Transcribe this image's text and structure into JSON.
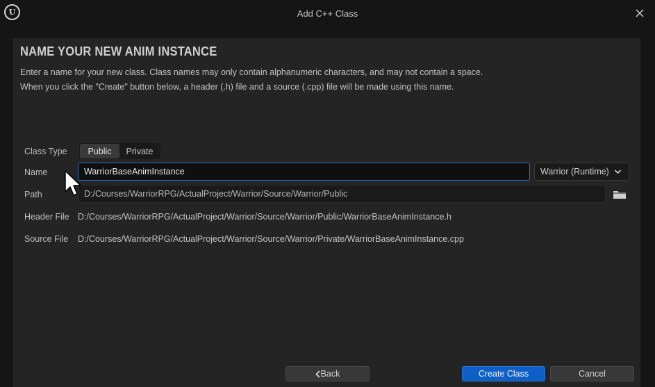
{
  "window": {
    "title": "Add C++ Class"
  },
  "content": {
    "heading": "NAME YOUR NEW ANIM INSTANCE",
    "description_line1": "Enter a name for your new class. Class names may only contain alphanumeric characters, and may not contain a space.",
    "description_line2": "When you click the \"Create\" button below, a header (.h) file and a source (.cpp) file will be made using this name."
  },
  "form": {
    "class_type_label": "Class Type",
    "class_type_options": [
      "Public",
      "Private"
    ],
    "class_type_selected": "Public",
    "name_label": "Name",
    "name_value": "WarriorBaseAnimInstance",
    "module_value": "Warrior (Runtime)",
    "path_label": "Path",
    "path_value": "D:/Courses/WarriorRPG/ActualProject/Warrior/Source/Warrior/Public",
    "header_file_label": "Header File",
    "header_file_value": "D:/Courses/WarriorRPG/ActualProject/Warrior/Source/Warrior/Public/WarriorBaseAnimInstance.h",
    "source_file_label": "Source File",
    "source_file_value": "D:/Courses/WarriorRPG/ActualProject/Warrior/Source/Warrior/Private/WarriorBaseAnimInstance.cpp"
  },
  "footer": {
    "back_label": "Back",
    "create_label": "Create Class",
    "cancel_label": "Cancel"
  },
  "colors": {
    "accent": "#0e5fc7",
    "focus_border": "#2a72c8",
    "background": "#151515",
    "panel": "#242424"
  },
  "icons": {
    "app": "unreal-engine-logo-icon",
    "close": "close-icon",
    "dropdown": "chevron-down-icon",
    "folder": "folder-icon",
    "back": "chevron-left-icon",
    "pointer": "mouse-pointer-icon"
  }
}
